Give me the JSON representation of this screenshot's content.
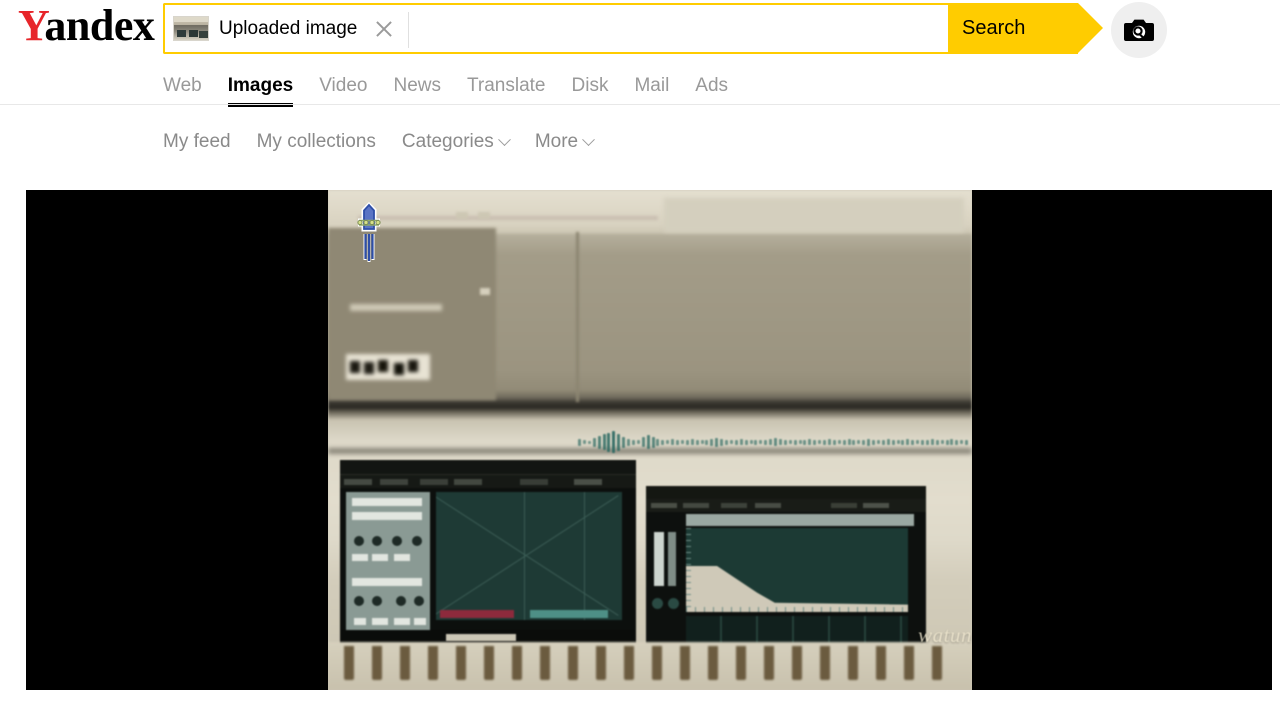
{
  "brand": {
    "logo_y": "Y",
    "logo_rest": "andex",
    "logo_accent_color": "#e7252a"
  },
  "search": {
    "chip_label": "Uploaded image",
    "chip_thumb_icon": "uploaded-image-thumbnail",
    "clear_icon": "close-icon",
    "input_value": "",
    "input_placeholder": "",
    "submit_label": "Search",
    "submit_color": "#ffcc00",
    "camera_icon": "camera-search-icon"
  },
  "service_tabs": [
    {
      "label": "Web",
      "active": false
    },
    {
      "label": "Images",
      "active": true
    },
    {
      "label": "Video",
      "active": false
    },
    {
      "label": "News",
      "active": false
    },
    {
      "label": "Translate",
      "active": false
    },
    {
      "label": "Disk",
      "active": false
    },
    {
      "label": "Mail",
      "active": false
    },
    {
      "label": "Ads",
      "active": false
    }
  ],
  "subnav": [
    {
      "label": "My feed",
      "caret": false
    },
    {
      "label": "My collections",
      "caret": false
    },
    {
      "label": "Categories",
      "caret": true
    },
    {
      "label": "More",
      "caret": true
    }
  ],
  "viewer": {
    "background_color": "#000000",
    "photo_description": "Blurry photograph of a computer monitor showing audio editing software with waveform and equalizer windows",
    "watermark_text": "watun"
  }
}
